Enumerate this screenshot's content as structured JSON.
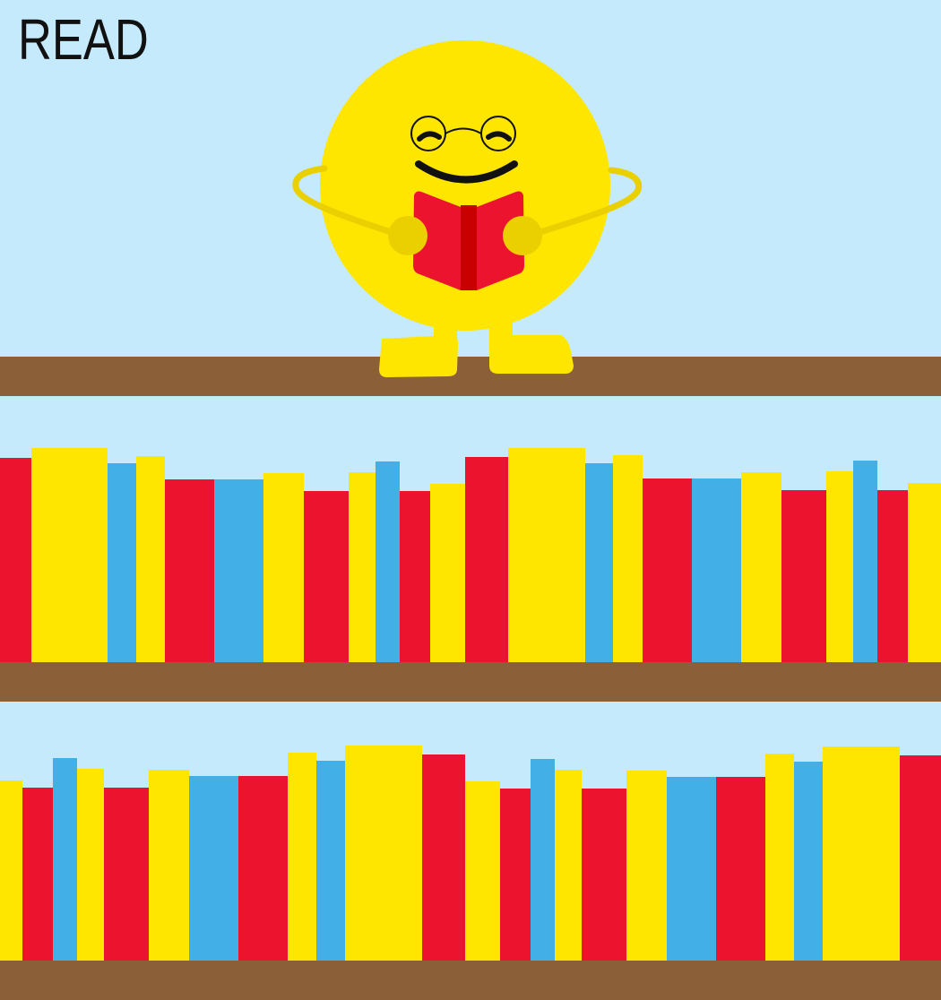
{
  "title": "READ",
  "colors": {
    "background": "#c5eafb",
    "shelf": "#8b5f37",
    "book_red": "#ec132f",
    "book_yellow": "#ffe600",
    "book_blue": "#42afe6",
    "character_body": "#ffe600",
    "character_limbs": "#ebd000",
    "held_book": "#ec132f",
    "held_book_spine": "#c80000"
  },
  "character": {
    "name": "reading-smiley",
    "expression": "happy-closed-eyes",
    "accessory": "round-glasses",
    "holding": "red-book"
  },
  "shelves": [
    {
      "name": "top-shelf",
      "book_colors": []
    },
    {
      "name": "middle-shelf",
      "book_colors": [
        "red",
        "yellow",
        "blue",
        "yellow",
        "red",
        "blue",
        "yellow",
        "red",
        "yellow",
        "blue",
        "red",
        "yellow",
        "red",
        "yellow",
        "blue",
        "yellow",
        "red",
        "blue",
        "yellow",
        "red",
        "yellow",
        "blue",
        "red",
        "yellow"
      ]
    },
    {
      "name": "bottom-shelf",
      "book_colors": [
        "yellow",
        "red",
        "blue",
        "yellow",
        "red",
        "yellow",
        "blue",
        "red",
        "yellow",
        "blue",
        "yellow",
        "red",
        "yellow",
        "red",
        "blue",
        "yellow",
        "red",
        "yellow",
        "blue",
        "red",
        "yellow",
        "blue",
        "yellow",
        "red"
      ]
    }
  ]
}
